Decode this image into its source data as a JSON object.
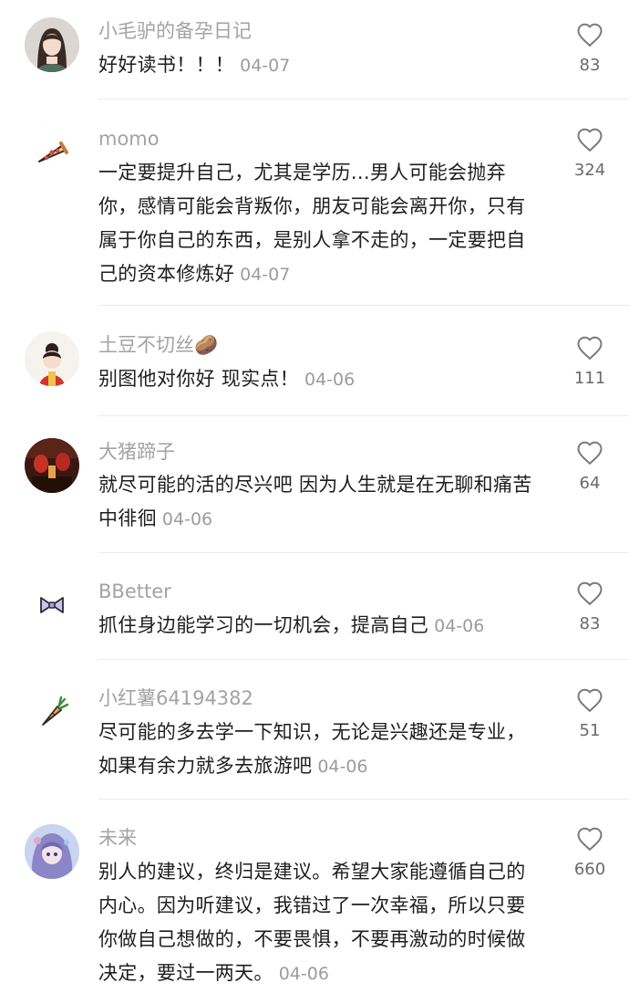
{
  "comments": [
    {
      "username": "小毛驴的备孕日记",
      "text": "好好读书！！！",
      "date": "04-07",
      "likes": "83",
      "avatar_icon": "girl-portrait-avatar"
    },
    {
      "username": "momo",
      "text": "一定要提升自己，尤其是学历...男人可能会抛弃你，感情可能会背叛你，朋友可能会离开你，只有属于你自己的东西，是别人拿不走的，一定要把自己的资本修炼好",
      "date": "04-07",
      "likes": "324",
      "avatar_icon": "pizza-slice-icon"
    },
    {
      "username": "土豆不切丝🥔",
      "text": "别图他对你好 现实点！",
      "date": "04-06",
      "likes": "111",
      "avatar_icon": "cartoon-girl-avatar"
    },
    {
      "username": "大猪蹄子",
      "text": "就尽可能的活的尽兴吧 因为人生就是在无聊和痛苦中徘徊",
      "date": "04-06",
      "likes": "64",
      "avatar_icon": "red-lantern-photo-avatar"
    },
    {
      "username": "BBetter",
      "text": "抓住身边能学习的一切机会，提高自己",
      "date": "04-06",
      "likes": "83",
      "avatar_icon": "bow-icon"
    },
    {
      "username": "小红薯64194382",
      "text": "尽可能的多去学一下知识，无论是兴趣还是专业，如果有余力就多去旅游吧",
      "date": "04-06",
      "likes": "51",
      "avatar_icon": "carrot-icon"
    },
    {
      "username": "未来",
      "text": "别人的建议，终归是建议。希望大家能遵循自己的内心。因为听建议，我错过了一次幸福，所以只要你做自己想做的，不要畏惧，不要再激动的时候做决定，要过一两天。",
      "date": "04-06",
      "likes": "660",
      "avatar_icon": "anime-girl-avatar"
    }
  ],
  "colors": {
    "username": "#a3a3a3",
    "text": "#1e1e1e",
    "date": "#9c9c9c",
    "like_icon": "#7a7a7a",
    "divider": "#ececec"
  }
}
